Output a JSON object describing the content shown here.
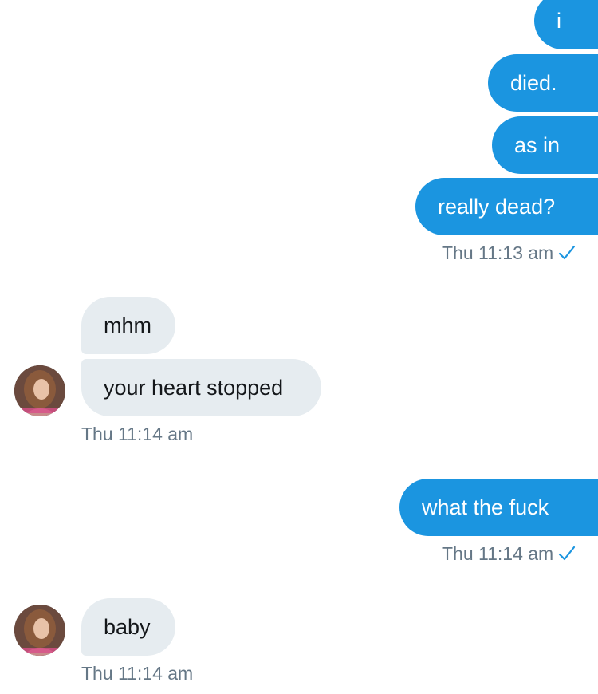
{
  "conversation": {
    "group1": {
      "messages": [
        "i",
        "died.",
        "as in",
        "really dead?"
      ],
      "timestamp": "Thu 11:13 am",
      "read_icon": "check-icon"
    },
    "group2": {
      "messages": [
        "mhm",
        "your heart stopped"
      ],
      "timestamp": "Thu 11:14 am",
      "avatar_icon": "profile-avatar"
    },
    "group3": {
      "messages": [
        "what the fuck"
      ],
      "timestamp": "Thu 11:14 am",
      "read_icon": "check-icon"
    },
    "group4": {
      "messages": [
        "baby"
      ],
      "timestamp": "Thu 11:14 am",
      "avatar_icon": "profile-avatar"
    }
  },
  "colors": {
    "outgoing_bubble": "#1b95e0",
    "incoming_bubble": "#e6ecf0",
    "timestamp_text": "#657786",
    "read_check": "#1b95e0"
  }
}
